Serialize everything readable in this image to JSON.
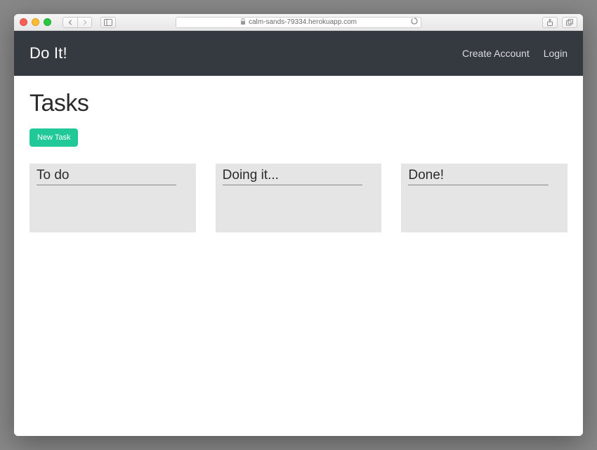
{
  "browser": {
    "url": "calm-sands-79334.herokuapp.com"
  },
  "navbar": {
    "brand": "Do It!",
    "links": {
      "create_account": "Create Account",
      "login": "Login"
    }
  },
  "page": {
    "title": "Tasks",
    "new_task_button": "New Task"
  },
  "columns": [
    {
      "title": "To do"
    },
    {
      "title": "Doing it..."
    },
    {
      "title": "Done!"
    }
  ]
}
